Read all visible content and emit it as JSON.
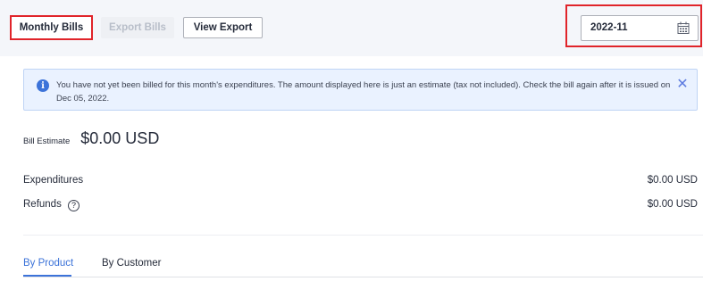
{
  "toolbar": {
    "monthly_bills": "Monthly Bills",
    "export_bills": "Export Bills",
    "view_export": "View Export"
  },
  "date_picker": {
    "value": "2022-11",
    "icon": "calendar-icon"
  },
  "notice": {
    "icon": "info-icon",
    "text": "You have not yet been billed for this month's expenditures. The amount displayed here is just an estimate (tax not included). Check the bill again after it is issued on Dec 05, 2022.",
    "close_symbol": "✕"
  },
  "summary": {
    "bill_estimate_label": "Bill Estimate",
    "bill_estimate_value": "$0.00 USD",
    "expenditures_label": "Expenditures",
    "expenditures_value": "$0.00 USD",
    "refunds_label": "Refunds",
    "refunds_value": "$0.00 USD",
    "help_symbol": "?"
  },
  "tabs": [
    {
      "label": "By Product",
      "active": true
    },
    {
      "label": "By Customer",
      "active": false
    }
  ],
  "colors": {
    "accent": "#3c73d9",
    "highlight": "#e0242a",
    "notice_bg": "#eaf2ff"
  }
}
